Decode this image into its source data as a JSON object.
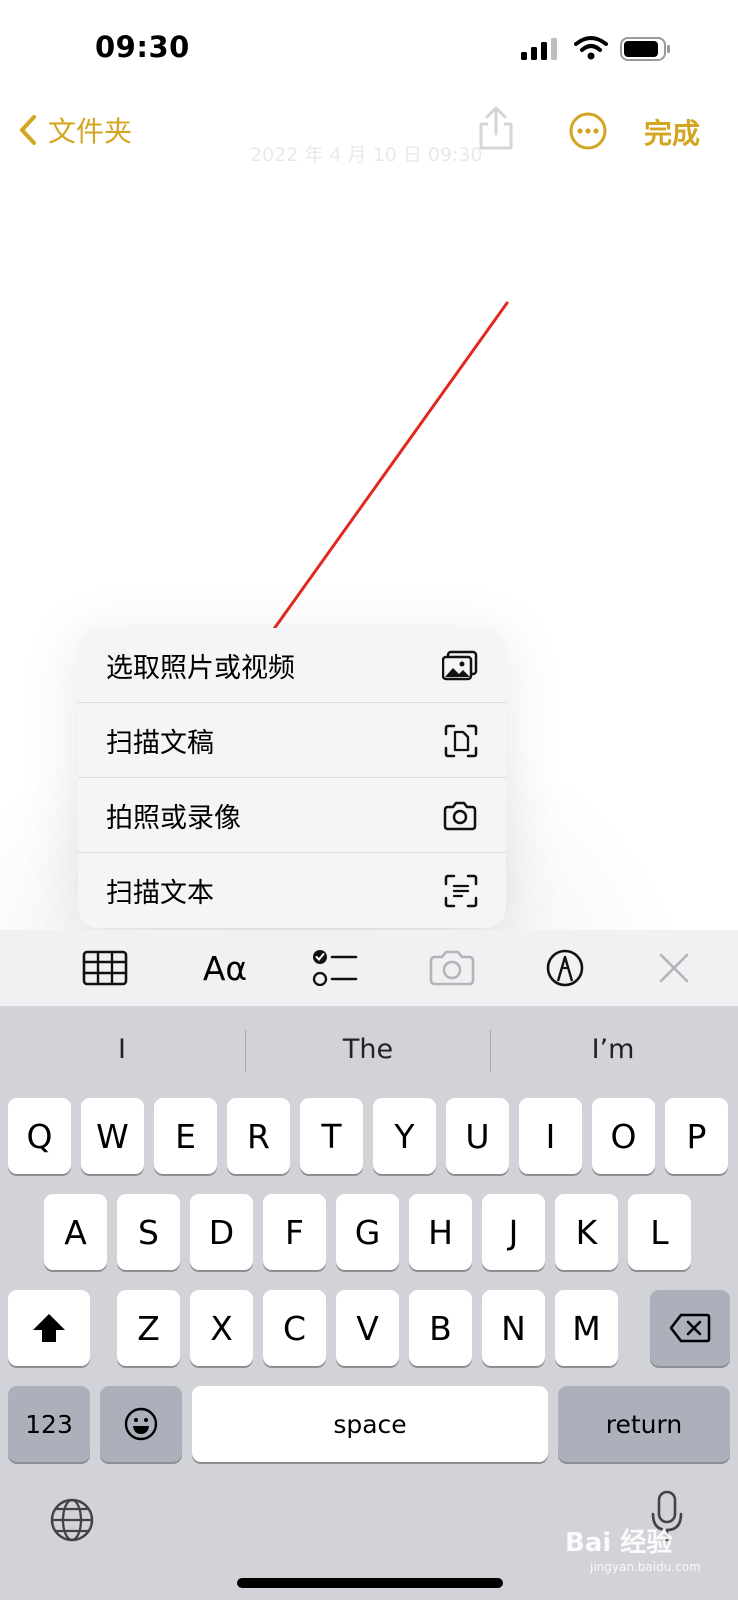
{
  "status_bar": {
    "time": "09:30"
  },
  "nav": {
    "back_label": "文件夹",
    "done_label": "完成",
    "faint_title": "2022 年 4 月 10 日 09:30",
    "accent_color": "#d4a520"
  },
  "popup_menu": {
    "items": [
      {
        "label": "选取照片或视频",
        "icon": "photo-library-icon"
      },
      {
        "label": "扫描文稿",
        "icon": "scan-document-icon"
      },
      {
        "label": "拍照或录像",
        "icon": "camera-icon"
      },
      {
        "label": "扫描文本",
        "icon": "scan-text-icon"
      }
    ]
  },
  "format_toolbar": {
    "items": [
      "table-icon",
      "text-format-icon",
      "checklist-icon",
      "camera-icon",
      "markup-pen-icon",
      "close-icon"
    ],
    "format_label": "Aα"
  },
  "keyboard": {
    "suggestions": [
      "I",
      "The",
      "I’m"
    ],
    "row1": [
      "Q",
      "W",
      "E",
      "R",
      "T",
      "Y",
      "U",
      "I",
      "O",
      "P"
    ],
    "row2": [
      "A",
      "S",
      "D",
      "F",
      "G",
      "H",
      "J",
      "K",
      "L"
    ],
    "row3": [
      "Z",
      "X",
      "C",
      "V",
      "B",
      "N",
      "M"
    ],
    "numbers_label": "123",
    "space_label": "space",
    "return_label": "return"
  },
  "annotation": {
    "arrow_color": "#e02a20"
  },
  "watermark": {
    "text": "Bai 经验",
    "sub": "jingyan.baidu.com"
  }
}
